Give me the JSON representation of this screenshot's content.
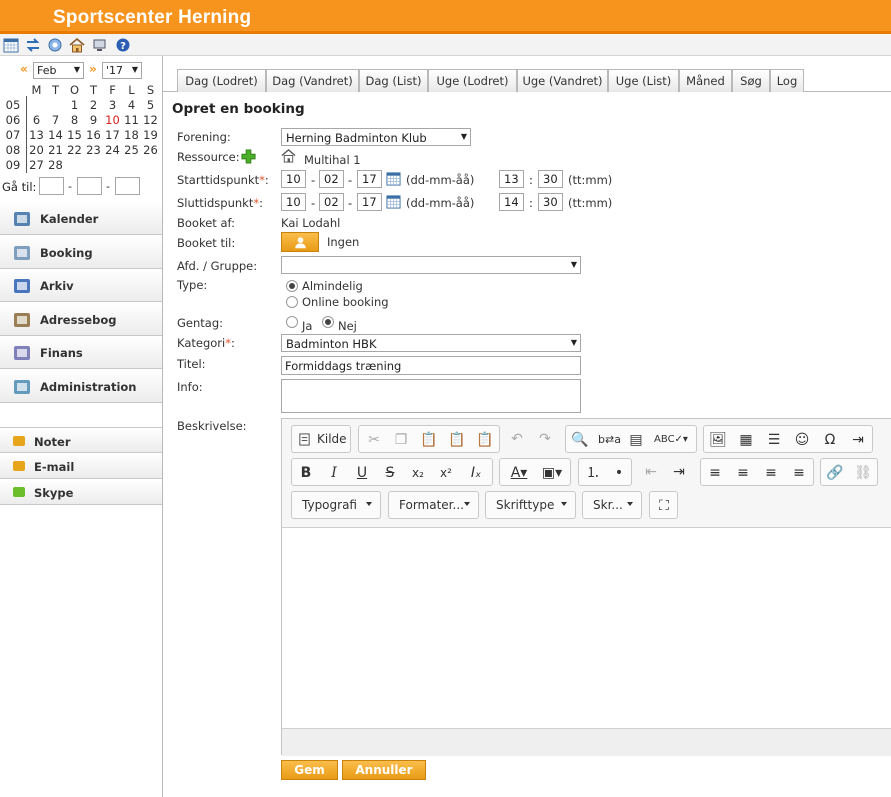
{
  "app": {
    "title": "Sportscenter Herning"
  },
  "toolbar": {
    "icons": [
      "calendar-icon",
      "swap-icon",
      "refresh-icon",
      "home-icon",
      "monitor-icon",
      "help-icon"
    ]
  },
  "calendar": {
    "month": "Feb",
    "year": "'17",
    "prev_arrow": "«",
    "next_arrow": "»",
    "weekdays": [
      "M",
      "T",
      "O",
      "T",
      "F",
      "L",
      "S"
    ],
    "weeks": [
      {
        "week": "05",
        "days": [
          "",
          "",
          "1",
          "2",
          "3",
          "4",
          "5"
        ]
      },
      {
        "week": "06",
        "days": [
          "6",
          "7",
          "8",
          "9",
          "10",
          "11",
          "12"
        ]
      },
      {
        "week": "07",
        "days": [
          "13",
          "14",
          "15",
          "16",
          "17",
          "18",
          "19"
        ]
      },
      {
        "week": "08",
        "days": [
          "20",
          "21",
          "22",
          "23",
          "24",
          "25",
          "26"
        ]
      },
      {
        "week": "09",
        "days": [
          "27",
          "28",
          "",
          "",
          "",
          "",
          ""
        ]
      }
    ],
    "today": "10",
    "goto_label": "Gå til:"
  },
  "menu": {
    "items": [
      {
        "label": "Kalender",
        "icon": "calendar-icon"
      },
      {
        "label": "Booking",
        "icon": "booking-icon"
      },
      {
        "label": "Arkiv",
        "icon": "archive-icon"
      },
      {
        "label": "Adressebog",
        "icon": "addressbook-icon"
      },
      {
        "label": "Finans",
        "icon": "finance-icon"
      },
      {
        "label": "Administration",
        "icon": "administration-icon"
      }
    ],
    "secondary": [
      {
        "label": "Noter",
        "icon": "notes-icon"
      },
      {
        "label": "E-mail",
        "icon": "email-icon"
      },
      {
        "label": "Skype",
        "icon": "skype-icon"
      }
    ]
  },
  "tabs": [
    "Dag (Lodret)",
    "Dag (Vandret)",
    "Dag (List)",
    "Uge (Lodret)",
    "Uge (Vandret)",
    "Uge (List)",
    "Måned",
    "Søg",
    "Log"
  ],
  "form": {
    "title": "Opret en booking",
    "forening_label": "Forening:",
    "forening_value": "Herning Badminton Klub",
    "ressource_label": "Ressource:",
    "ressource_value": "Multihal 1",
    "start_label": "Starttidspunkt",
    "slut_label": "Sluttidspunkt",
    "required_mark": "*",
    "colon": ":",
    "start": {
      "day": "10",
      "month": "02",
      "year": "17",
      "hour": "13",
      "minute": "30"
    },
    "slut": {
      "day": "10",
      "month": "02",
      "year": "17",
      "hour": "14",
      "minute": "30"
    },
    "date_format": "(dd-mm-åå)",
    "time_format": "(tt:mm)",
    "date_sep": "-",
    "time_sep": ":",
    "booket_af_label": "Booket af:",
    "booket_af_value": "Kai Lodahl",
    "booket_til_label": "Booket til:",
    "booket_til_value": "Ingen",
    "afd_label": "Afd. / Gruppe:",
    "afd_value": "",
    "type_label": "Type:",
    "type_options": [
      "Almindelig",
      "Online booking"
    ],
    "gentag_label": "Gentag:",
    "gentag_options": [
      "Ja",
      "Nej"
    ],
    "kategori_label": "Kategori",
    "kategori_value": "Badminton HBK",
    "titel_label": "Titel:",
    "titel_value": "Formiddags træning",
    "info_label": "Info:",
    "info_value": "",
    "beskrivelse_label": "Beskrivelse:"
  },
  "editor": {
    "source_label": "Kilde",
    "combos": [
      "Typografi",
      "Formater...",
      "Skrifttype",
      "Skr..."
    ]
  },
  "buttons": {
    "save": "Gem",
    "cancel": "Annuller"
  }
}
